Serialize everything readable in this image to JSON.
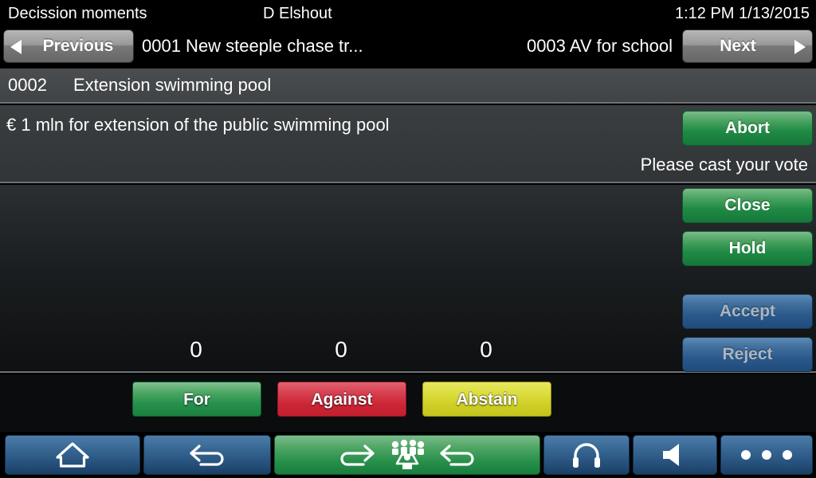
{
  "statusbar": {
    "title": "Decission moments",
    "user": "D Elshout",
    "clock": "1:12 PM 1/13/2015"
  },
  "nav": {
    "previous_label": "Previous",
    "next_label": "Next",
    "previous_item": "0001 New steeple chase tr...",
    "next_item": "0003 AV for school",
    "prev_arrow_icon": "triangle-left-icon",
    "next_arrow_icon": "triangle-right-icon"
  },
  "item": {
    "number": "0002",
    "title": "Extension swimming pool",
    "description": "€ 1 mln for extension of the public swimming pool",
    "status_message": "Please cast your vote"
  },
  "actions": {
    "abort": "Abort",
    "close": "Close",
    "hold": "Hold",
    "accept": "Accept",
    "reject": "Reject"
  },
  "results": {
    "for_count": "0",
    "against_count": "0",
    "abstain_count": "0"
  },
  "vote": {
    "for_label": "For",
    "against_label": "Against",
    "abstain_label": "Abstain"
  },
  "toolbar": {
    "home_icon": "home-icon",
    "back_icon": "arrow-back-icon",
    "transfer_forward_icon": "arrow-forward-icon",
    "group_icon": "group-people-icon",
    "transfer_back_icon": "arrow-back-icon",
    "headset_icon": "headphones-icon",
    "speaker_icon": "speaker-icon",
    "more_icon": "more-dots-icon"
  },
  "colors": {
    "green": "#1f8a45",
    "blue": "#2b588a",
    "red": "#cc2636",
    "yellow": "#cfd026",
    "gray_button": "#9a9a9a",
    "panel_dark": "#1b1e20",
    "panel_mid": "#3a3e40"
  }
}
